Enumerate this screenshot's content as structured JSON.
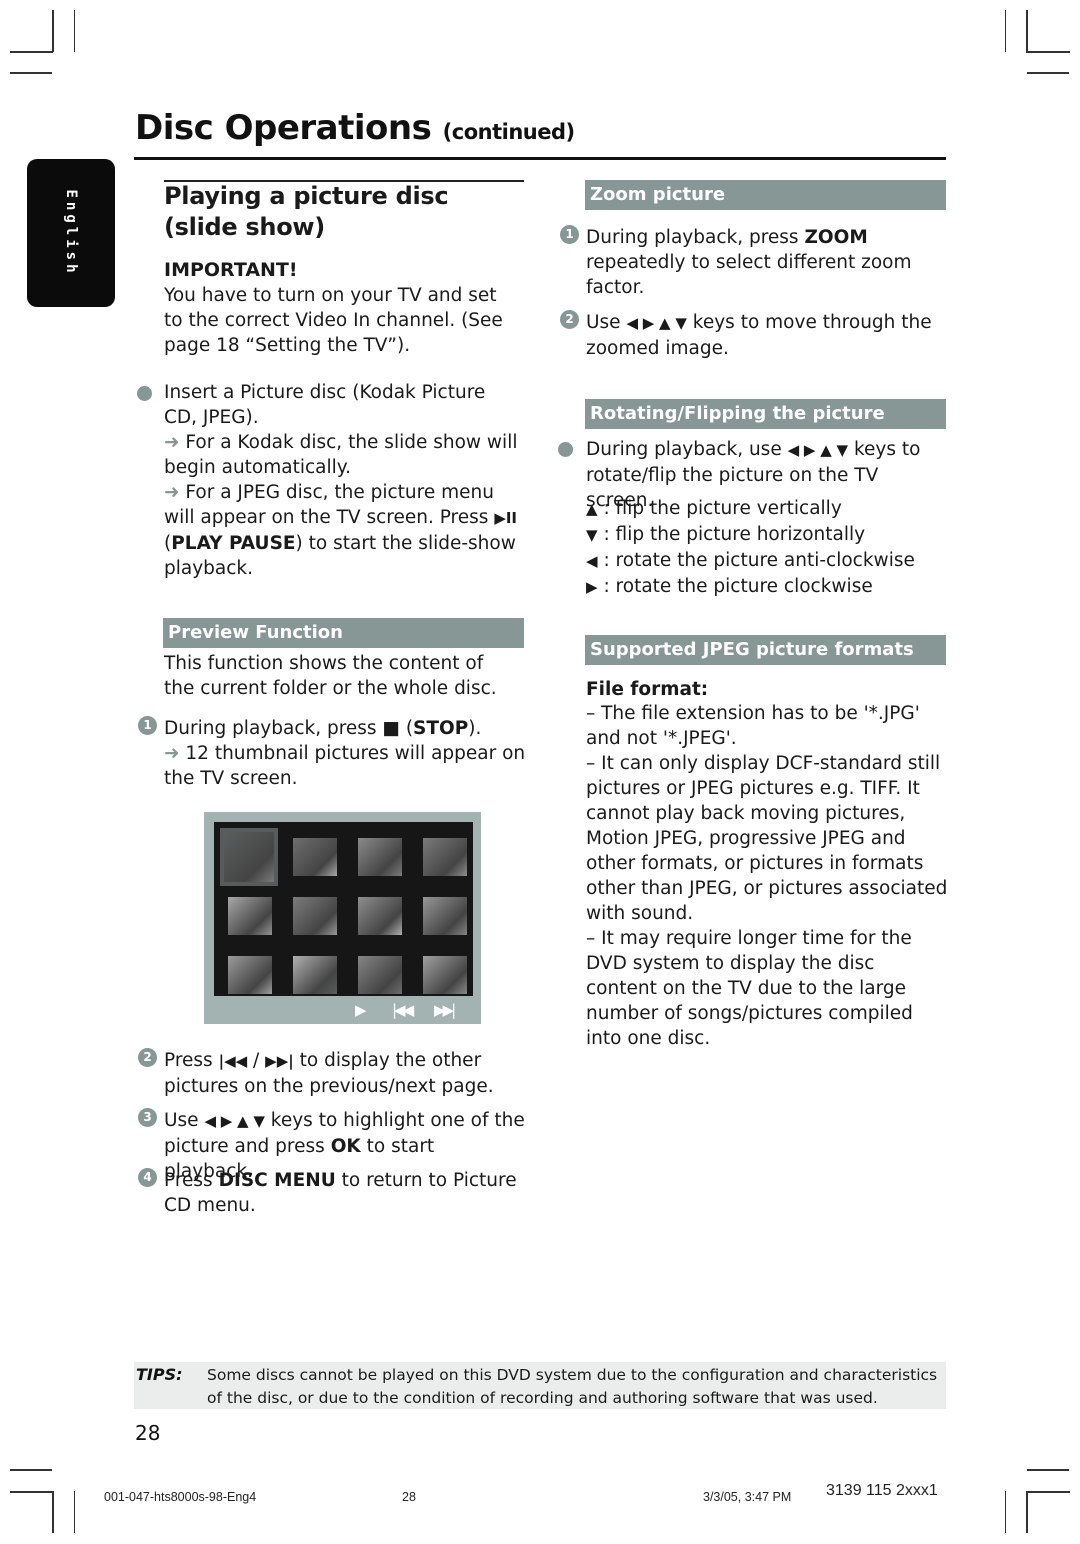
{
  "header": {
    "title": "Disc Operations",
    "title_suffix": "(continued)"
  },
  "language_tab": "English",
  "left": {
    "section_title": "Playing a picture disc (slide show)",
    "important_label": "IMPORTANT!",
    "important_text": "You have to turn on your TV and set to the correct Video In channel.  (See page 18 “Setting the TV”).",
    "insert": {
      "text": "Insert a Picture disc (Kodak Picture CD, JPEG).",
      "result1": "For a Kodak disc, the slide show will begin automatically.",
      "result2_a": "For a JPEG disc, the picture menu will appear on the TV screen.  Press",
      "play_pause_icon": "▶II",
      "result2_b_open": "(",
      "result2_b_key": "PLAY PAUSE",
      "result2_b_rest": ") to start the slide-show playback."
    },
    "preview": {
      "bar_label": "Preview Function",
      "intro": "This function shows the content of the current folder or the whole disc.",
      "step1_a": "During playback, press",
      "stop_icon": "■",
      "step1_key": "STOP",
      "step1_result": "12 thumbnail pictures will appear on the TV screen.",
      "step2_a": "Press",
      "prev_icon": "|◀◀",
      "sep": "/",
      "next_icon": "▶▶|",
      "step2_b": "to display the other pictures on the previous/next page.",
      "step3_a": "Use",
      "arrow_keys": "◀ ▶ ▲ ▼",
      "step3_b": "keys to highlight one of the picture and press",
      "step3_key": "OK",
      "step3_c": "to start playback.",
      "step4_a": "Press",
      "step4_key": "DISC MENU",
      "step4_b": "to return to Picture CD menu."
    },
    "screen": {
      "thumbnail_count": 12,
      "controls": {
        "play": "▶",
        "prev": "|◀◀",
        "next": "▶▶|"
      }
    }
  },
  "right": {
    "zoom": {
      "bar_label": "Zoom picture",
      "step1_a": "During playback, press",
      "step1_key": "ZOOM",
      "step1_b": "repeatedly to select different zoom factor.",
      "step2_a": "Use",
      "arrow_keys": "◀ ▶ ▲ ▼",
      "step2_b": "keys to move through the zoomed image."
    },
    "rotate": {
      "bar_label": "Rotating/Flipping the picture",
      "intro_a": "During playback, use",
      "arrow_keys": "◀ ▶ ▲ ▼",
      "intro_b": "keys to rotate/flip the picture on the TV screen.",
      "items": [
        {
          "icon": "▲",
          "text": ": flip the picture vertically"
        },
        {
          "icon": "▼",
          "text": ": flip the picture horizontally"
        },
        {
          "icon": "◀",
          "text": ": rotate the picture anti-clockwise"
        },
        {
          "icon": "▶",
          "text": ": rotate the picture clockwise"
        }
      ]
    },
    "jpeg": {
      "bar_label": "Supported JPEG picture formats",
      "file_format_label": "File format:",
      "points": [
        "–  The file extension has to be '*.JPG' and not '*.JPEG'.",
        "–  It can only display DCF-standard still pictures or JPEG pictures e.g. TIFF.  It cannot play back moving pictures, Motion JPEG, progressive JPEG and other formats, or pictures in formats other than JPEG, or pictures associated with sound.",
        "–  It may require longer time for the DVD system to display the disc content on the TV due to the large number of songs/pictures compiled into one disc."
      ]
    }
  },
  "tips": {
    "label": "TIPS:",
    "text": "Some discs cannot be played on this DVD system due to the configuration and characteristics of the disc, or due to the condition of recording and authoring software that was used."
  },
  "page_number": "28",
  "footer": {
    "file": "001-047-hts8000s-98-Eng4",
    "page": "28",
    "date": "3/3/05, 3:47 PM",
    "code": "3139 115 2xxx1"
  },
  "step_numbers": [
    "1",
    "2",
    "3",
    "4"
  ]
}
